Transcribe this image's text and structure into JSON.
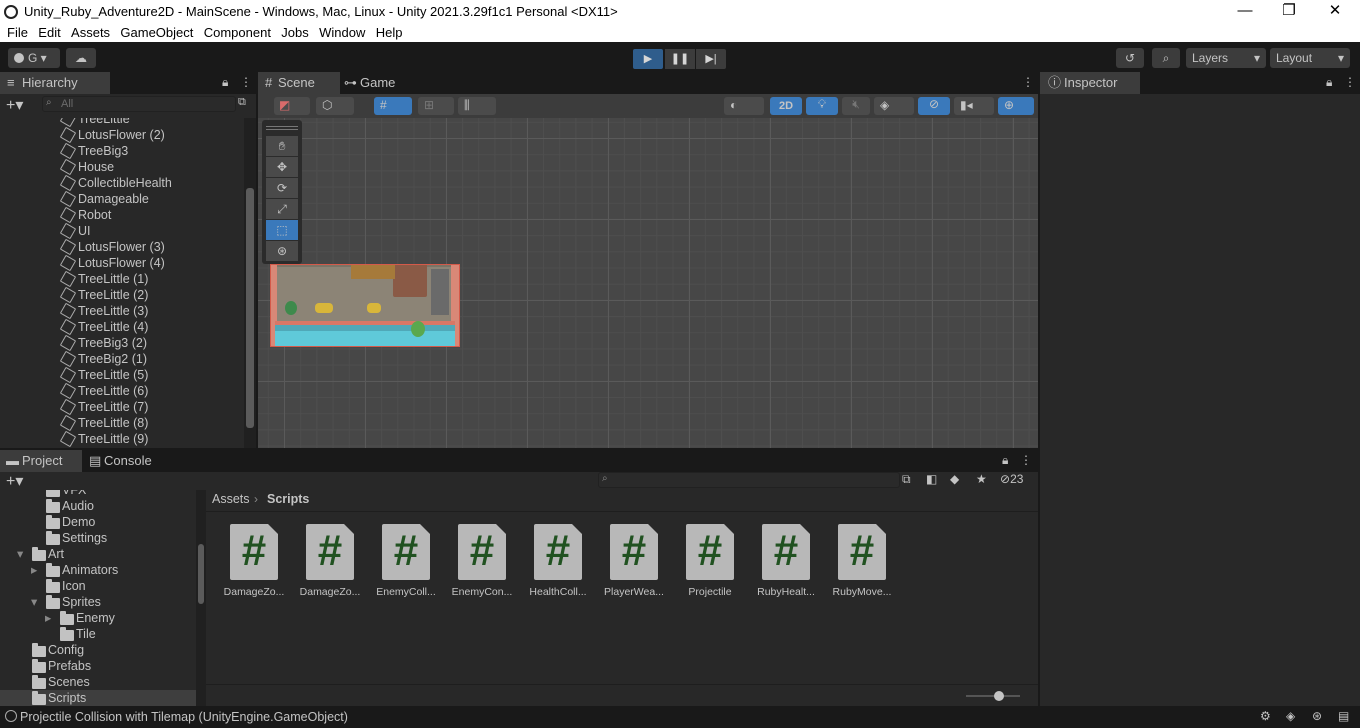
{
  "window": {
    "title": "Unity_Ruby_Adventure2D - MainScene - Windows, Mac, Linux - Unity 2021.3.29f1c1 Personal <DX11>",
    "minimize": "—",
    "maximize": "❐",
    "close": "✕"
  },
  "menu": [
    "File",
    "Edit",
    "Assets",
    "GameObject",
    "Component",
    "Jobs",
    "Window",
    "Help"
  ],
  "toolbar": {
    "account": "G",
    "layers": "Layers",
    "layout": "Layout"
  },
  "hierarchy": {
    "tab": "Hierarchy",
    "search_placeholder": "All",
    "items": [
      "TreeLittle",
      "LotusFlower (2)",
      "TreeBig3",
      "House",
      "CollectibleHealth",
      "Damageable",
      "Robot",
      "UI",
      "LotusFlower (3)",
      "LotusFlower (4)",
      "TreeLittle (1)",
      "TreeLittle (2)",
      "TreeLittle (3)",
      "TreeLittle (4)",
      "TreeBig3 (2)",
      "TreeBig2 (1)",
      "TreeLittle (5)",
      "TreeLittle (6)",
      "TreeLittle (7)",
      "TreeLittle (8)",
      "TreeLittle (9)"
    ]
  },
  "scene": {
    "tab_scene": "Scene",
    "tab_game": "Game",
    "mode_2d": "2D"
  },
  "inspector": {
    "tab": "Inspector"
  },
  "project": {
    "tab_project": "Project",
    "tab_console": "Console",
    "hidden_count": "23",
    "breadcrumb": [
      "Assets",
      "Scripts"
    ],
    "tree": [
      {
        "label": "VFX",
        "indent": 0
      },
      {
        "label": "Audio",
        "indent": 0
      },
      {
        "label": "Demo",
        "indent": 0
      },
      {
        "label": "Settings",
        "indent": 0
      },
      {
        "label": "Art",
        "indent": -1
      },
      {
        "label": "Animators",
        "indent": 1
      },
      {
        "label": "Icon",
        "indent": 1
      },
      {
        "label": "Sprites",
        "indent": 1
      },
      {
        "label": "Enemy",
        "indent": 2
      },
      {
        "label": "Tile",
        "indent": 2
      },
      {
        "label": "Config",
        "indent": -1
      },
      {
        "label": "Prefabs",
        "indent": -1
      },
      {
        "label": "Scenes",
        "indent": -1
      },
      {
        "label": "Scripts",
        "indent": -1
      }
    ],
    "assets": [
      "DamageZo...",
      "DamageZo...",
      "EnemyColl...",
      "EnemyCon...",
      "HealthColl...",
      "PlayerWea...",
      "Projectile",
      "RubyHealt...",
      "RubyMove..."
    ]
  },
  "status": {
    "message": "Projectile Collision with Tilemap (UnityEngine.GameObject)"
  },
  "colors": {
    "accent": "#3a79bb",
    "play_bg": "#2f5d8c",
    "panel": "#282828",
    "background": "#191919",
    "script_hash": "#215221"
  }
}
